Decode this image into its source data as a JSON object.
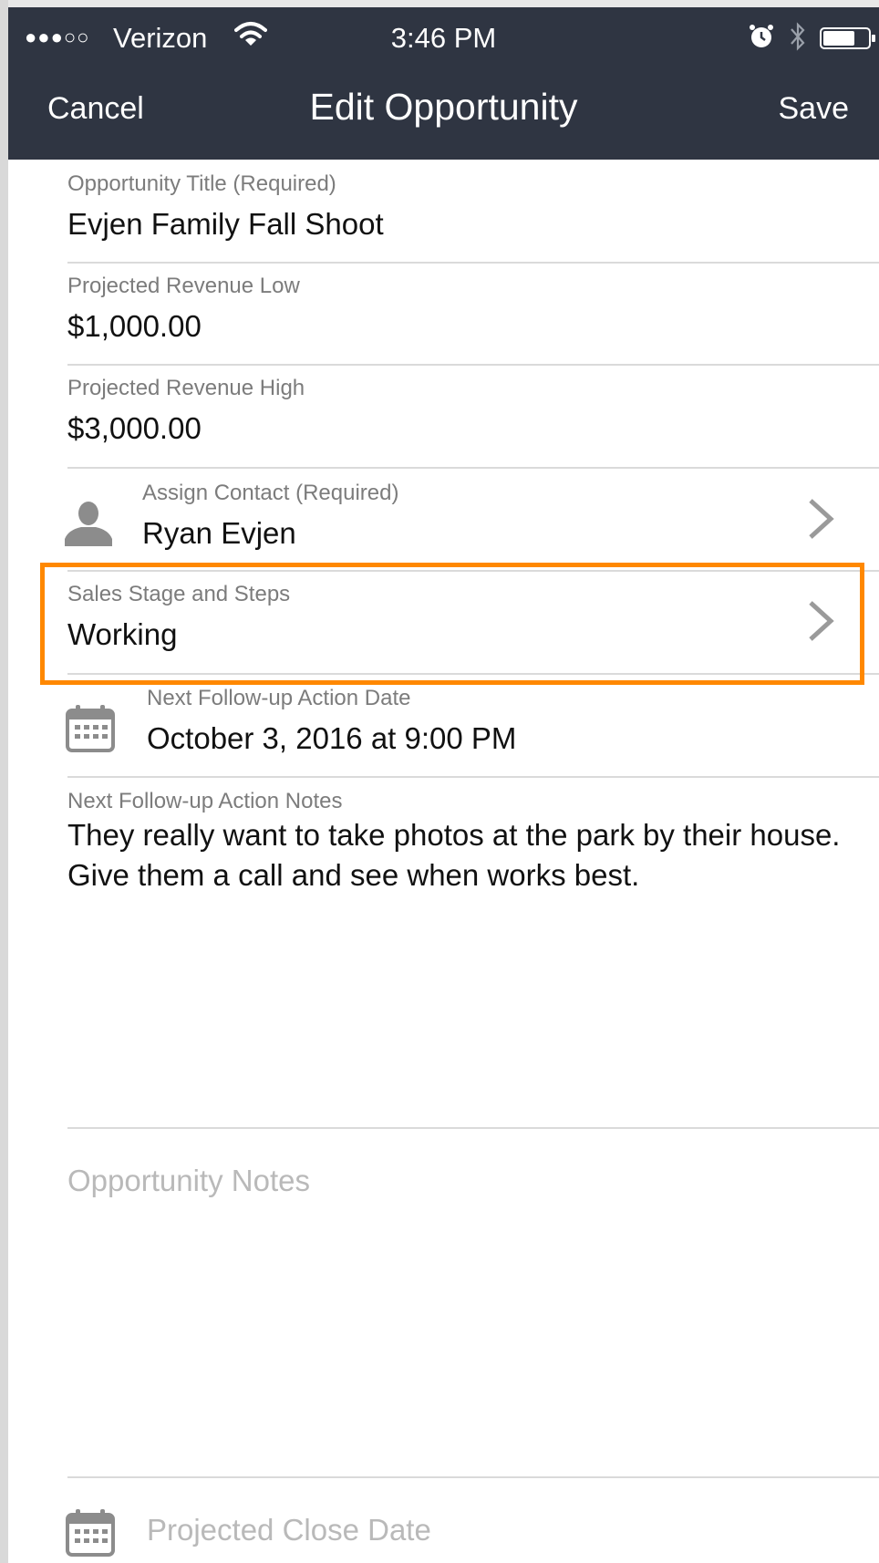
{
  "status_bar": {
    "signal": "●●●○○",
    "carrier": "Verizon",
    "time": "3:46 PM"
  },
  "nav": {
    "cancel_label": "Cancel",
    "title": "Edit Opportunity",
    "save_label": "Save"
  },
  "form": {
    "title": {
      "label": "Opportunity Title (Required)",
      "value": "Evjen Family Fall Shoot"
    },
    "revenue_low": {
      "label": "Projected Revenue Low",
      "value": "$1,000.00"
    },
    "revenue_high": {
      "label": "Projected Revenue High",
      "value": "$3,000.00"
    },
    "contact": {
      "label": "Assign Contact (Required)",
      "value": "Ryan Evjen"
    },
    "sales_stage": {
      "label": "Sales Stage and Steps",
      "value": "Working"
    },
    "follow_up_date": {
      "label": "Next Follow-up Action Date",
      "value": "October 3, 2016 at 9:00 PM"
    },
    "follow_up_notes": {
      "label": "Next Follow-up Action Notes",
      "value": "They really want to take photos at the park by their house. Give them a call and see when works best."
    },
    "opportunity_notes": {
      "placeholder": "Opportunity Notes"
    },
    "close_date": {
      "placeholder": "Projected Close Date"
    }
  },
  "colors": {
    "header_bg": "#2f3542",
    "highlight": "#ff8800",
    "label": "#7c7c7c",
    "placeholder": "#b9b9b9"
  },
  "icons": {
    "contact": "person-icon",
    "date": "calendar-icon",
    "disclosure": "chevron-right-icon"
  }
}
